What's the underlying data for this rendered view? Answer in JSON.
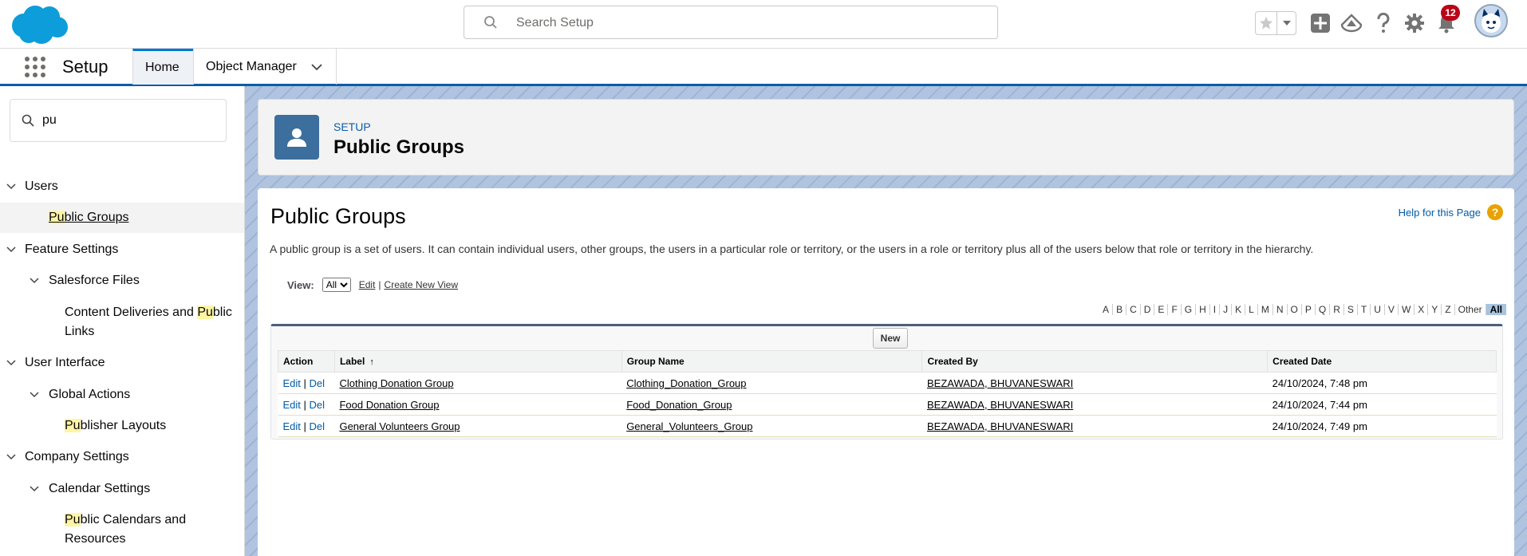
{
  "header": {
    "search_placeholder": "Search Setup",
    "notification_count": "12"
  },
  "nav": {
    "app_name": "Setup",
    "tabs": [
      {
        "label": "Home"
      },
      {
        "label": "Object Manager"
      }
    ]
  },
  "sidebar": {
    "quickfind_value": "pu",
    "items": [
      {
        "label": "Users"
      },
      {
        "hl": "Pu",
        "rest": "blic Groups"
      },
      {
        "label": "Feature Settings"
      },
      {
        "label": "Salesforce Files"
      },
      {
        "pre": "Content Deliveries and ",
        "hl": "Pu",
        "rest": "blic",
        "line2": "Links"
      },
      {
        "label": "User Interface"
      },
      {
        "label": "Global Actions"
      },
      {
        "hl": "Pu",
        "rest": "blisher Layouts"
      },
      {
        "label": "Company Settings"
      },
      {
        "label": "Calendar Settings"
      },
      {
        "hl": "Pu",
        "rest": "blic Calendars and",
        "line2": "Resources"
      }
    ]
  },
  "page_header": {
    "eyebrow": "SETUP",
    "title": "Public Groups"
  },
  "content": {
    "title": "Public Groups",
    "help_label": "Help for this Page",
    "description": "A public group is a set of users. It can contain individual users, other groups, the users in a particular role or territory, or the users in a role or territory plus all of the users below that role or territory in the hierarchy.",
    "view_label": "View:",
    "view_selected": "All",
    "edit_link": "Edit",
    "create_view_link": "Create New View",
    "alpha": [
      "A",
      "B",
      "C",
      "D",
      "E",
      "F",
      "G",
      "H",
      "I",
      "J",
      "K",
      "L",
      "M",
      "N",
      "O",
      "P",
      "Q",
      "R",
      "S",
      "T",
      "U",
      "V",
      "W",
      "X",
      "Y",
      "Z",
      "Other",
      "All"
    ],
    "new_button": "New",
    "table": {
      "headers": [
        "Action",
        "Label",
        "Group Name",
        "Created By",
        "Created Date"
      ],
      "sort_indicator": "↑",
      "edit_label": "Edit",
      "del_label": "Del",
      "rows": [
        {
          "label": "Clothing Donation Group",
          "group_name": "Clothing_Donation_Group",
          "created_by": "BEZAWADA, BHUVANESWARI",
          "created_date": "24/10/2024, 7:48 pm"
        },
        {
          "label": "Food Donation Group",
          "group_name": "Food_Donation_Group",
          "created_by": "BEZAWADA, BHUVANESWARI",
          "created_date": "24/10/2024, 7:44 pm"
        },
        {
          "label": "General Volunteers Group",
          "group_name": "General_Volunteers_Group",
          "created_by": "BEZAWADA, BHUVANESWARI",
          "created_date": "24/10/2024, 7:49 pm"
        }
      ]
    }
  },
  "colors": {
    "brand_blue": "#0176d3",
    "nav_border": "#0b5cab",
    "badge_red": "#ba0517",
    "highlight": "#fff5a5"
  }
}
